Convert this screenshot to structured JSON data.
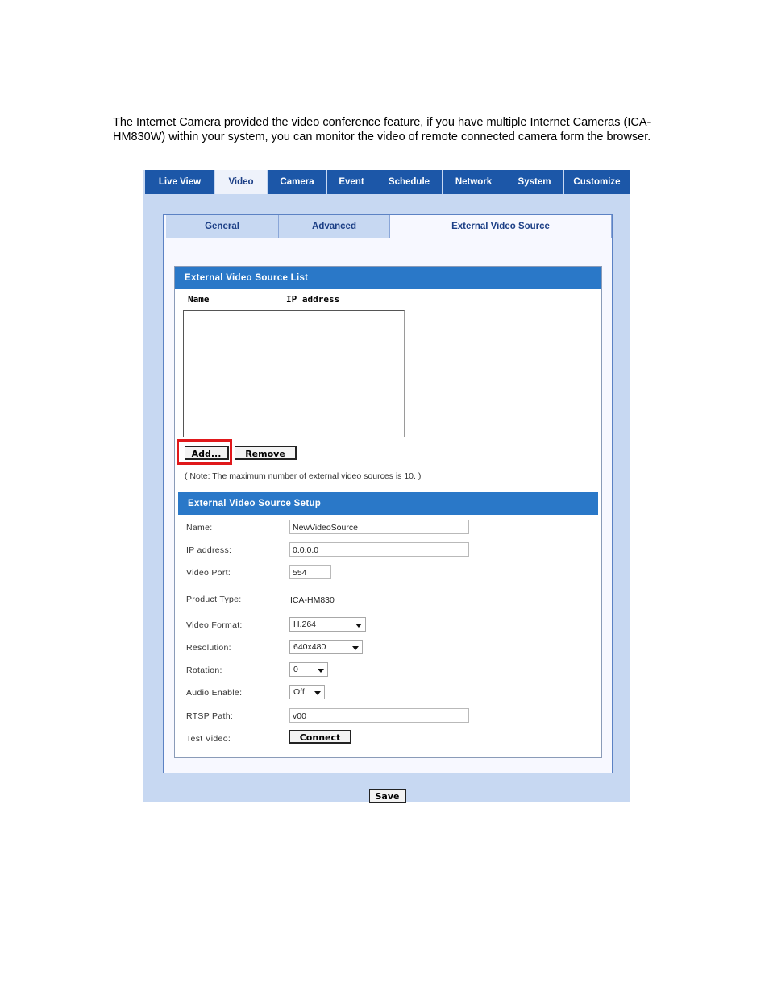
{
  "intro_text": "The Internet Camera provided the video conference feature, if you have multiple Internet Cameras (ICA-HM830W) within your system, you can monitor the video of remote connected camera form the browser.",
  "main_tabs": [
    "Live View",
    "Video",
    "Camera",
    "Event",
    "Schedule",
    "Network",
    "System",
    "Customize"
  ],
  "active_main_tab": "Video",
  "sub_tabs": [
    "General",
    "Advanced",
    "External Video Source"
  ],
  "active_sub_tab": "External Video Source",
  "list_section": {
    "title": "External Video Source List",
    "col_name": "Name",
    "col_ip": "IP address",
    "add_label": "Add...",
    "remove_label": "Remove",
    "note": "( Note: The maximum number of external video sources is 10. )"
  },
  "setup_section": {
    "title": "External Video Source Setup",
    "name_label": "Name:",
    "name_value": "NewVideoSource",
    "ip_label": "IP address:",
    "ip_value": "0.0.0.0",
    "port_label": "Video Port:",
    "port_value": "554",
    "product_label": "Product Type:",
    "product_value": "ICA-HM830",
    "format_label": "Video Format:",
    "format_value": "H.264",
    "resolution_label": "Resolution:",
    "resolution_value": "640x480",
    "rotation_label": "Rotation:",
    "rotation_value": "0",
    "audio_label": "Audio Enable:",
    "audio_value": "Off",
    "rtsp_label": "RTSP Path:",
    "rtsp_value": "v00",
    "test_label": "Test Video:",
    "connect_label": "Connect"
  },
  "save_label": "Save",
  "colors": {
    "tab_blue": "#1c57a8",
    "bar_blue": "#2a78c8",
    "panel_bg": "#c7d8f2",
    "highlight": "#e0181b"
  }
}
